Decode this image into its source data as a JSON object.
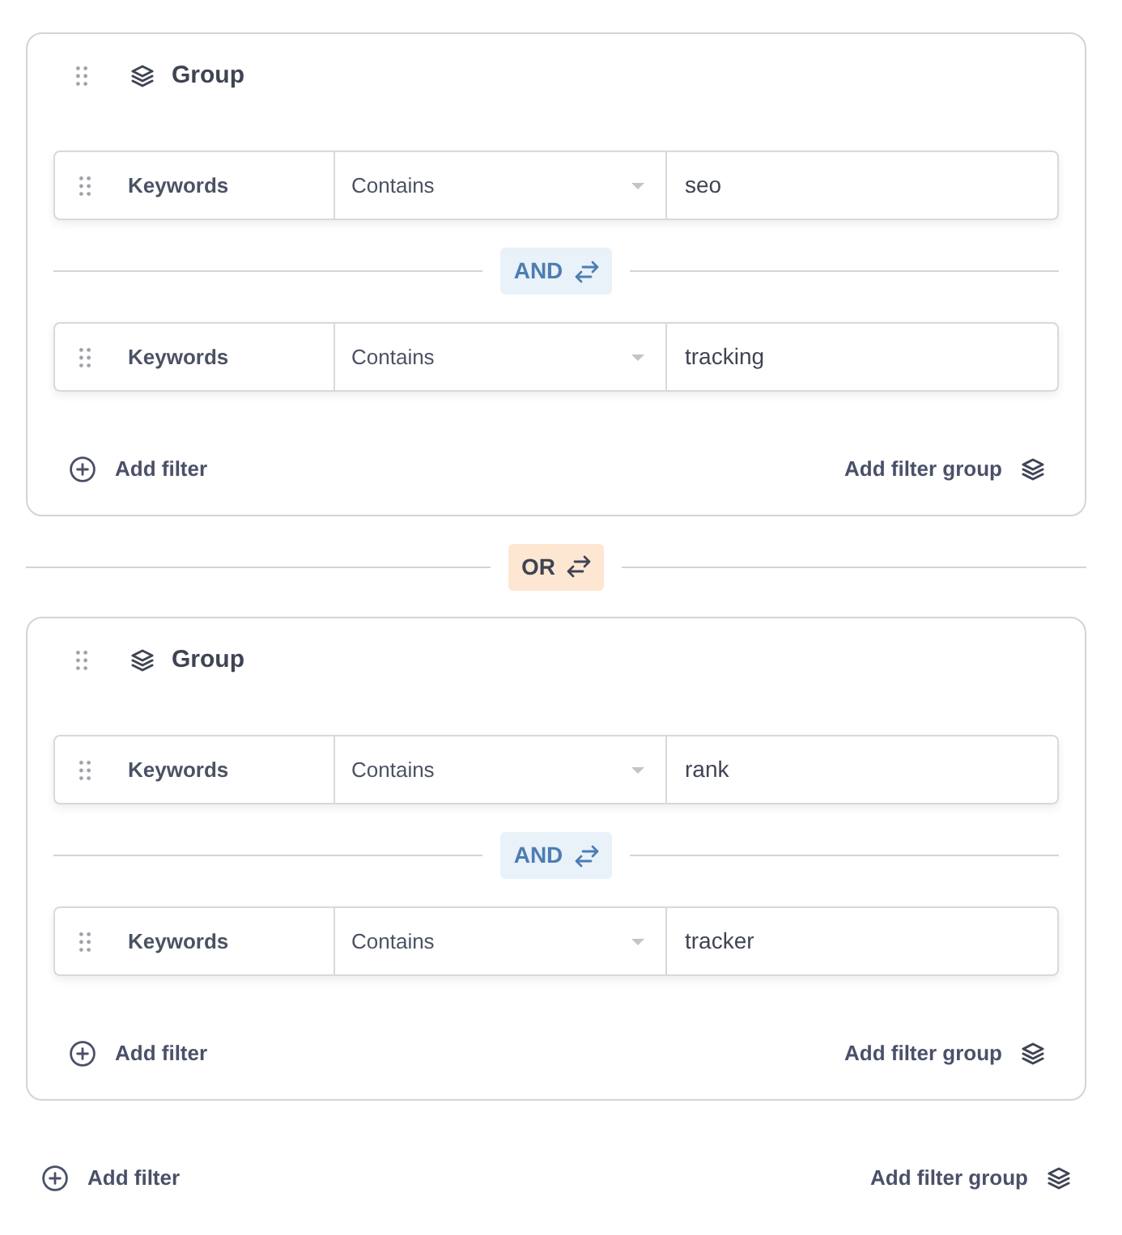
{
  "items": [
    {
      "kind": "group",
      "title": "Group",
      "items": [
        {
          "kind": "filter",
          "field": "Keywords",
          "operator": "Contains",
          "value": "seo"
        },
        {
          "kind": "and",
          "label": "AND"
        },
        {
          "kind": "filter",
          "field": "Keywords",
          "operator": "Contains",
          "value": "tracking"
        }
      ],
      "add_filter": "Add filter",
      "add_filter_group": "Add filter group"
    },
    {
      "kind": "or",
      "label": "OR"
    },
    {
      "kind": "group",
      "title": "Group",
      "items": [
        {
          "kind": "filter",
          "field": "Keywords",
          "operator": "Contains",
          "value": "rank"
        },
        {
          "kind": "and",
          "label": "AND"
        },
        {
          "kind": "filter",
          "field": "Keywords",
          "operator": "Contains",
          "value": "tracker"
        }
      ],
      "add_filter": "Add filter",
      "add_filter_group": "Add filter group"
    }
  ],
  "add_filter": "Add filter",
  "add_filter_group": "Add filter group"
}
